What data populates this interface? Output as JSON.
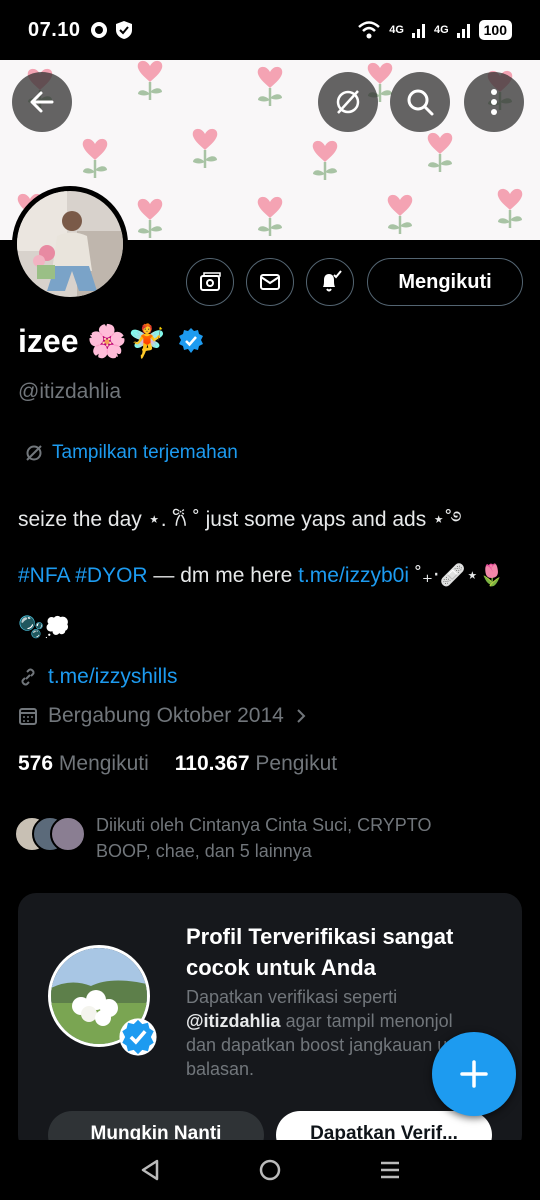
{
  "status_bar": {
    "time": "07.10",
    "net1": "4G",
    "net2": "4G",
    "battery": "100"
  },
  "profile": {
    "name": "izee 🌸🧚",
    "handle": "@itizdahlia",
    "translate_label": "Tampilkan terjemahan",
    "bio_line1": "seize the day ⋆. 𐙚 ˚ just some yaps and ads ⋆˚࿔",
    "bio_hashtag1": "#NFA",
    "bio_hashtag2": "#DYOR",
    "bio_mid": " — dm me here ",
    "bio_link": "t.me/izzyb0i",
    "bio_end": " ˚₊‧🩹⋆🌷",
    "bio_line3": "🫧💭",
    "website": "t.me/izzyshills",
    "joined": "Bergabung Oktober 2014",
    "following_count": "576",
    "following_label": "Mengikuti",
    "followers_count": "110.367",
    "followers_label": "Pengikut",
    "followed_by": "Diikuti oleh Cintanya Cinta Suci, CRYPTO BOOP, chae, dan 5 lainnya"
  },
  "actions": {
    "follow_label": "Mengikuti"
  },
  "verify_card": {
    "title": "Profil Terverifikasi sangat cocok untuk Anda",
    "desc_pre": "Dapatkan verifikasi seperti ",
    "desc_handle": "@itizdahlia",
    "desc_post": " agar tampil menonjol dan dapatkan boost jangkauan untuk balasan.",
    "later_label": "Mungkin Nanti",
    "get_label": "Dapatkan Verif..."
  },
  "colors": {
    "accent": "#1d9bf0",
    "muted": "#71767b",
    "background": "#000000",
    "card": "#16181c"
  }
}
